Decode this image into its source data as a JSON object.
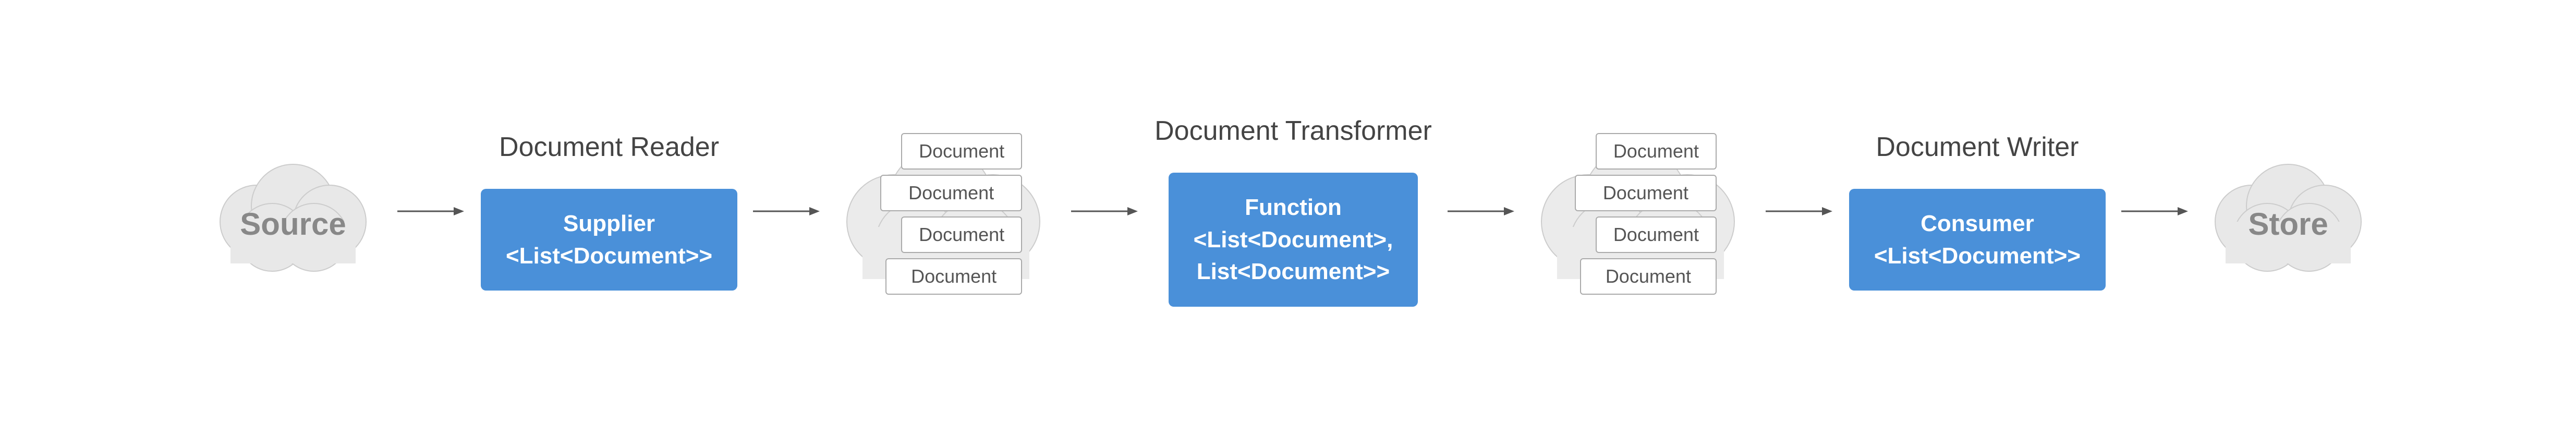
{
  "diagram": {
    "source_label": "Source",
    "store_label": "Store",
    "doc_reader_label": "Document Reader",
    "doc_transformer_label": "Document Transformer",
    "doc_writer_label": "Document Writer",
    "supplier_box": {
      "line1": "Supplier",
      "line2": "<List<Document>>"
    },
    "function_box": {
      "line1": "Function",
      "line2": "<List<Document>,",
      "line3": "List<Document>>"
    },
    "consumer_box": {
      "line1": "Consumer",
      "line2": "<List<Document>>"
    },
    "documents": {
      "doc_label": "Document"
    }
  },
  "colors": {
    "blue": "#4A90D9",
    "text_gray": "#666",
    "label_gray": "#444",
    "doc_border": "#aaa",
    "arrow_color": "#555"
  }
}
